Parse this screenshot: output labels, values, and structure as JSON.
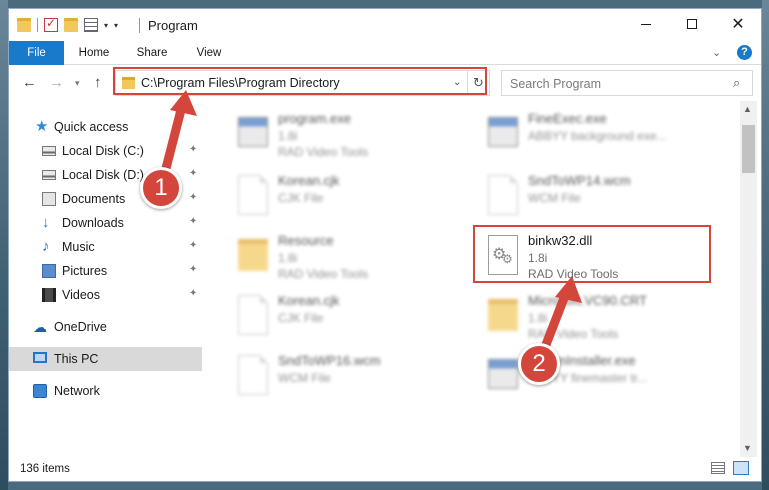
{
  "window": {
    "title": "Program",
    "controls": {
      "minimize": "minimize",
      "maximize": "maximize",
      "close": "✕"
    }
  },
  "ribbon": {
    "tabs": [
      {
        "label": "File",
        "active": true
      },
      {
        "label": "Home"
      },
      {
        "label": "Share"
      },
      {
        "label": "View"
      }
    ],
    "help": "?"
  },
  "nav": {
    "back": "←",
    "forward": "→",
    "recent": "⌄",
    "up": "↑",
    "address": "C:\\Program Files\\Program Directory",
    "refresh": "↻",
    "search_placeholder": "Search Program",
    "search_icon": "🔍"
  },
  "sidebar": {
    "items": [
      {
        "label": "Quick access",
        "icon": "star-icon",
        "pinned": false
      },
      {
        "label": "Local Disk (C:)",
        "icon": "drive-icon",
        "pinned": true
      },
      {
        "label": "Local Disk (D:)",
        "icon": "drive-icon",
        "pinned": true
      },
      {
        "label": "Documents",
        "icon": "documents-icon",
        "pinned": true
      },
      {
        "label": "Downloads",
        "icon": "download-icon",
        "pinned": true
      },
      {
        "label": "Music",
        "icon": "music-icon",
        "pinned": true
      },
      {
        "label": "Pictures",
        "icon": "pictures-icon",
        "pinned": true
      },
      {
        "label": "Videos",
        "icon": "videos-icon",
        "pinned": true
      },
      {
        "label": "OneDrive",
        "icon": "cloud-icon",
        "pinned": false
      },
      {
        "label": "This PC",
        "icon": "computer-icon",
        "pinned": false,
        "selected": true
      },
      {
        "label": "Network",
        "icon": "network-icon",
        "pinned": false
      }
    ],
    "pin_glyph": "📌"
  },
  "files": {
    "left": [
      {
        "name": "program.exe",
        "line2": "1.8i",
        "line3": "RAD Video Tools",
        "kind": "exe"
      },
      {
        "name": "Korean.cjk",
        "line2": "CJK File",
        "line3": "",
        "kind": "doc"
      },
      {
        "name": "Resource",
        "line2": "1.8i",
        "line3": "RAD Video Tools",
        "kind": "folder"
      },
      {
        "name": "Korean.cjk",
        "line2": "CJK File",
        "line3": "",
        "kind": "doc"
      },
      {
        "name": "SndToWP16.wcm",
        "line2": "WCM File",
        "line3": "",
        "kind": "doc"
      }
    ],
    "right": [
      {
        "name": "FineExec.exe",
        "line2": "ABBYY background exe...",
        "line3": "",
        "kind": "exe"
      },
      {
        "name": "SndToWP14.wcm",
        "line2": "WCM File",
        "line3": "",
        "kind": "doc"
      },
      {
        "name": "binkw32.dll",
        "line2": "1.8i",
        "line3": "RAD Video Tools",
        "kind": "dll",
        "highlight": true
      },
      {
        "name": "Microsoft.VC90.CRT",
        "line2": "1.8i",
        "line3": "RAD Video Tools",
        "kind": "folder"
      },
      {
        "name": "ParamInstaller.exe",
        "line2": "ABBYY finemaster tr...",
        "line3": "",
        "kind": "exe"
      }
    ]
  },
  "statusbar": {
    "item_count": "136 items"
  },
  "annotations": {
    "step1": "1",
    "step2": "2",
    "color": "#d4453c"
  },
  "colors": {
    "accent": "#1979ca",
    "selection": "#d9d9d9"
  }
}
